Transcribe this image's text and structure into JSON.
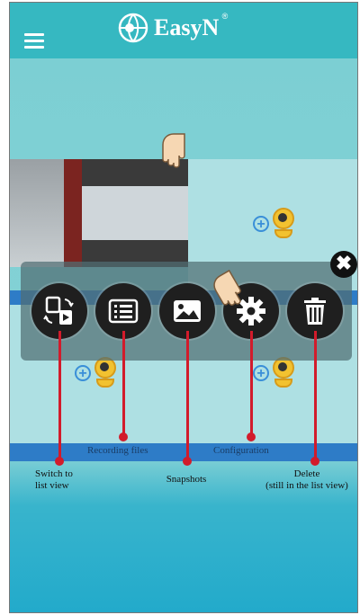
{
  "app": {
    "logo_text": "EasyN",
    "logo_mark": "®"
  },
  "icons": {
    "menu": "hamburger-icon",
    "close": "close-icon",
    "switch_view": "switch-view-icon",
    "recording_files": "list-icon",
    "snapshots": "image-icon",
    "configuration": "gear-icon",
    "delete": "trash-icon",
    "add_camera": "add-camera-icon",
    "pointer": "hand-pointer-icon"
  },
  "close_glyph": "✖",
  "band_labels": {
    "recording_files": "Recording files",
    "configuration": "Configuration"
  },
  "callouts": {
    "switch_view": [
      "Switch to",
      "list  view"
    ],
    "snapshots": "Snapshots",
    "delete": [
      "Delete",
      "(still in the list view)"
    ]
  },
  "colors": {
    "accent": "#36b8c1",
    "callout": "#d21b2b",
    "band": "#2e7cc7"
  }
}
